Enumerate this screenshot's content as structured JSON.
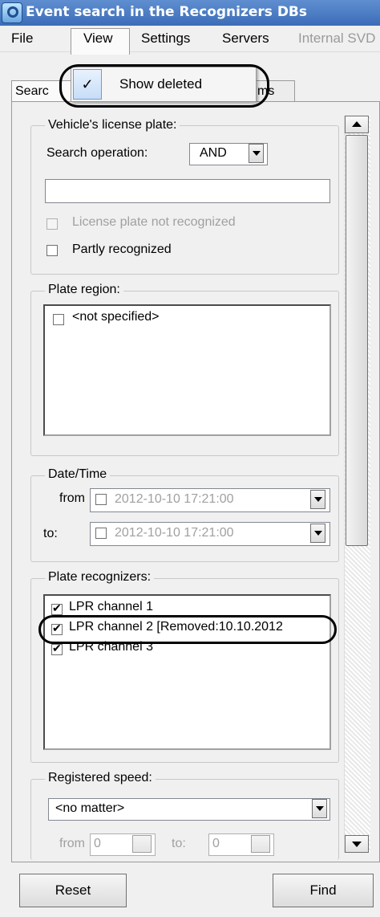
{
  "window": {
    "title": "Event search in the Recognizers DBs"
  },
  "menubar": {
    "file": "File",
    "view": "View",
    "settings": "Settings",
    "servers": "Servers",
    "internal": "Internal SVD"
  },
  "view_menu": {
    "show_deleted": "Show deleted",
    "show_deleted_checked": "✓"
  },
  "tabs": {
    "search_partial": "Searc",
    "other_partial": "ms"
  },
  "license_plate": {
    "legend": "Vehicle's license plate:",
    "search_operation_label": "Search operation:",
    "search_operation_value": "AND",
    "plate_input_value": "",
    "not_recognized_label": "License plate not recognized",
    "partly_recognized_label": "Partly recognized"
  },
  "plate_region": {
    "legend": "Plate region:",
    "items": [
      "<not specified>"
    ]
  },
  "datetime": {
    "legend": "Date/Time",
    "from_label": "from",
    "from_value": "2012-10-10 17:21:00",
    "to_label": "to:",
    "to_value": "2012-10-10 17:21:00"
  },
  "recognizers": {
    "legend": "Plate recognizers:",
    "items": [
      "LPR channel 1",
      "LPR channel 2 [Removed:10.10.2012",
      "LPR channel 3"
    ]
  },
  "speed": {
    "legend": "Registered speed:",
    "mode_value": "<no matter>",
    "from_label": "from",
    "from_value": "0",
    "to_label": "to:",
    "to_value": "0"
  },
  "buttons": {
    "reset": "Reset",
    "find": "Find"
  }
}
